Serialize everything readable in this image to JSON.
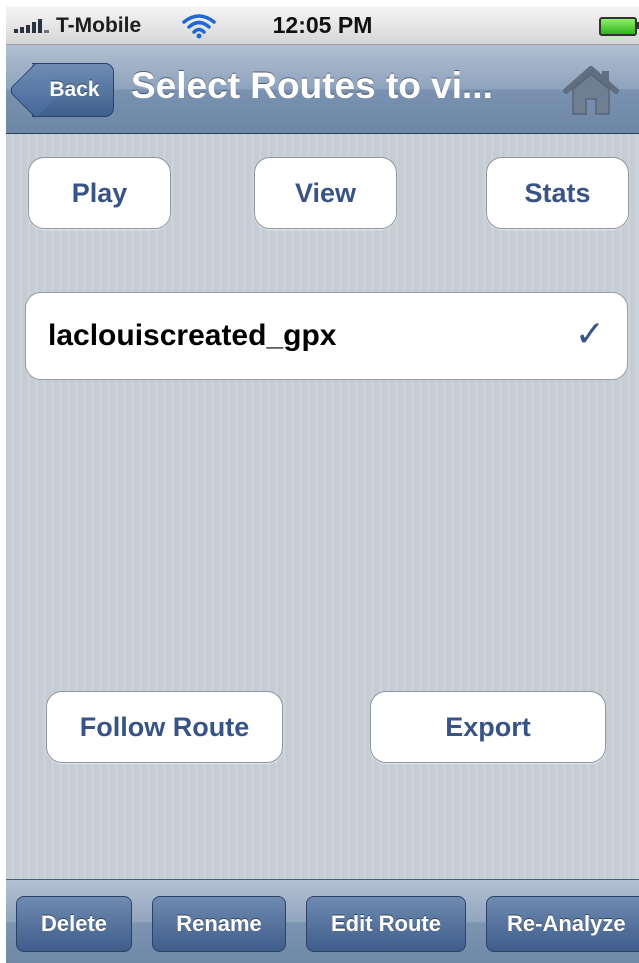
{
  "status_bar": {
    "carrier": "T-Mobile",
    "time": "12:05 PM",
    "signal_icon": "signal-bars-icon",
    "wifi_icon": "wifi-icon",
    "battery_icon": "battery-full-icon"
  },
  "nav": {
    "back_label": "Back",
    "title": "Select Routes to vi...",
    "home_icon": "home-icon"
  },
  "actions": {
    "play": "Play",
    "view": "View",
    "stats": "Stats"
  },
  "routes": [
    {
      "name": "laclouiscreated_gpx",
      "selected": true,
      "check": "✓"
    }
  ],
  "secondary_actions": {
    "follow_route": "Follow Route",
    "export": "Export"
  },
  "toolbar": {
    "delete": "Delete",
    "rename": "Rename",
    "edit_route": "Edit Route",
    "re_analyze": "Re-Analyze"
  },
  "colors": {
    "accent_text": "#385487",
    "toolbar_button": "#4f6d99",
    "background": "#c5ccd4"
  }
}
